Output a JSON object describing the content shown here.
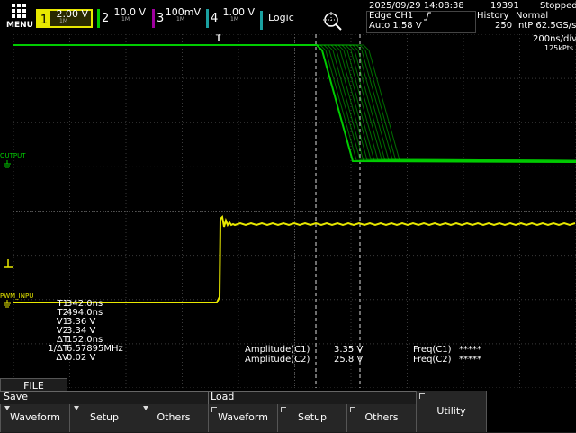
{
  "menu": {
    "label": "MENU"
  },
  "channels": {
    "ch1": {
      "num": "1",
      "scale": "2.00 V",
      "color": "#e8e800"
    },
    "ch2": {
      "num": "2",
      "scale": "10.0 V",
      "color": "#00cc00"
    },
    "ch3": {
      "num": "3",
      "scale": "100mV",
      "color": "#a000a0"
    },
    "ch4": {
      "num": "4",
      "scale": "1.00 V",
      "color": "#1aa0a0"
    },
    "logic": "Logic",
    "coupling": "1M"
  },
  "status": {
    "datetime": "2025/09/29 14:08:38",
    "count": "19391",
    "state": "Stopped",
    "trigger_line1": "Edge CH1",
    "trigger_line2": "Auto 1.58 V",
    "history_label": "History",
    "history_value": "250",
    "acq_mode": "Normal",
    "sample": "IntP 62.5GS/s",
    "timebase": "200ns/div",
    "record_length": "125kPts"
  },
  "waveforms": {
    "ch2_label": "OUTPUT",
    "ch1_label": "PWM_INPU"
  },
  "cursors": {
    "T1": "342.0ns",
    "T2": "494.0ns",
    "V1": "3.36 V",
    "V2": "3.34 V",
    "dT": "152.0ns",
    "inv_dT": "6.57895MHz",
    "dV": "0.02 V",
    "labels": {
      "T1": "T1",
      "T2": "T2",
      "V1": "V1",
      "V2": "V2",
      "dT": "ΔT",
      "inv_dT": "1/ΔT",
      "dV": "ΔV"
    }
  },
  "measurements": {
    "amp_c1_label": "Amplitude(C1)",
    "amp_c1_value": "3.35 V",
    "amp_c2_label": "Amplitude(C2)",
    "amp_c2_value": "25.8 V",
    "freq_c1_label": "Freq(C1)",
    "freq_c1_value": "*****",
    "freq_c2_label": "Freq(C2)",
    "freq_c2_value": "*****"
  },
  "softkeys": {
    "file_tab": "FILE",
    "save_group": "Save",
    "load_group": "Load",
    "save_waveform": "Waveform",
    "save_setup": "Setup",
    "save_others": "Others",
    "load_waveform": "Waveform",
    "load_setup": "Setup",
    "load_others": "Others",
    "utility": "Utility"
  }
}
